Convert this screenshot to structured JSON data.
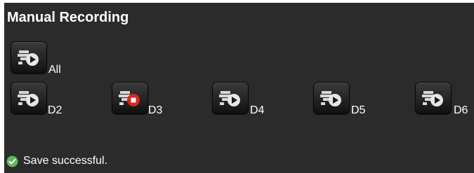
{
  "title": "Manual Recording",
  "channels": [
    {
      "label": "All",
      "recording": false,
      "icon": "camera-play-icon"
    },
    {
      "label": "D2",
      "recording": false,
      "icon": "camera-play-icon"
    },
    {
      "label": "D3",
      "recording": true,
      "icon": "camera-record-icon"
    },
    {
      "label": "D4",
      "recording": false,
      "icon": "camera-play-icon"
    },
    {
      "label": "D5",
      "recording": false,
      "icon": "camera-play-icon"
    },
    {
      "label": "D6",
      "recording": false,
      "icon": "camera-play-icon"
    }
  ],
  "status": {
    "text": "Save successful.",
    "icon": "check-circle-icon"
  },
  "colors": {
    "panel_bg": "#2b2b2b",
    "text": "#ffffff",
    "success": "#5cb85c",
    "record": "#d9251c"
  }
}
